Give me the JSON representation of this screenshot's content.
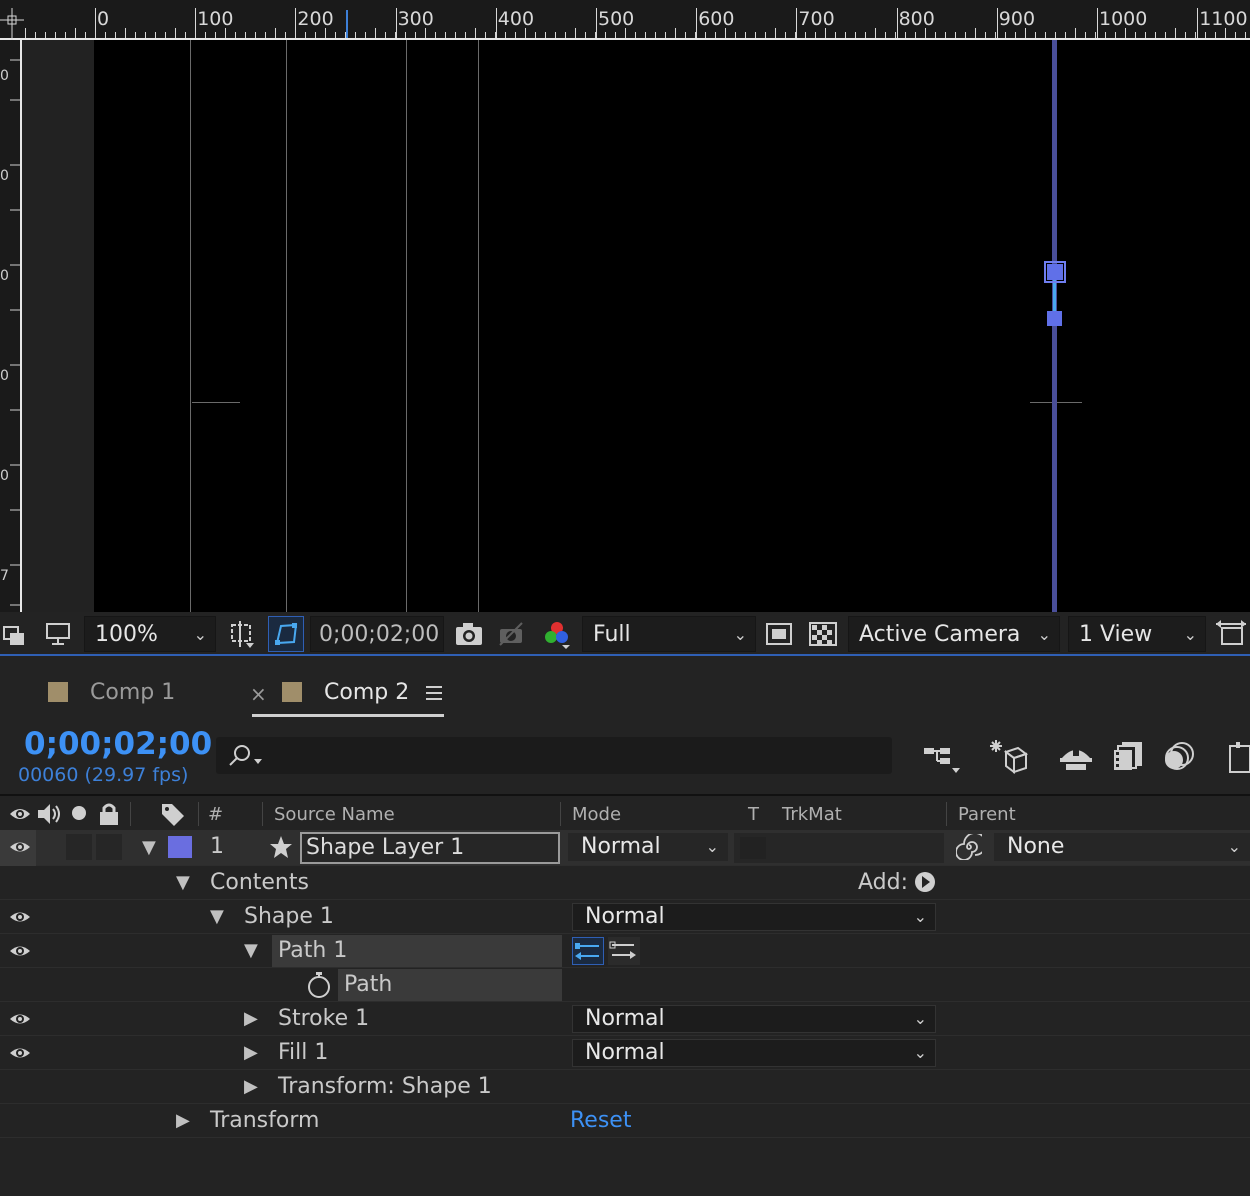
{
  "ruler": {
    "labels": [
      "0",
      "100",
      "200",
      "300",
      "400",
      "500",
      "600",
      "700",
      "800",
      "900",
      "1000",
      "1100"
    ]
  },
  "viewer_toolbar": {
    "zoom": "100%",
    "timecode": "0;00;02;00",
    "resolution": "Full",
    "camera": "Active Camera",
    "views": "1 View"
  },
  "tabs": [
    {
      "label": "Comp 1",
      "active": false
    },
    {
      "label": "Comp 2",
      "active": true
    }
  ],
  "timeline": {
    "current_time": "0;00;02;00",
    "frames": "00060 (29.97 fps)",
    "columns": {
      "num": "#",
      "source_name": "Source Name",
      "mode": "Mode",
      "t": "T",
      "trkmat": "TrkMat",
      "parent": "Parent"
    },
    "layer": {
      "index": "1",
      "name": "Shape Layer 1",
      "mode": "Normal",
      "parent": "None",
      "label_color": "#6a6ee0"
    },
    "rows": {
      "contents": "Contents",
      "add": "Add:",
      "shape1": "Shape 1",
      "shape1_mode": "Normal",
      "path1": "Path 1",
      "path": "Path",
      "stroke1": "Stroke 1",
      "stroke1_mode": "Normal",
      "fill1": "Fill 1",
      "fill1_mode": "Normal",
      "transform_shape": "Transform: Shape 1",
      "transform": "Transform",
      "reset": "Reset"
    }
  },
  "colors": {
    "accent": "#3d91f5",
    "path_handle": "#6070e8"
  }
}
